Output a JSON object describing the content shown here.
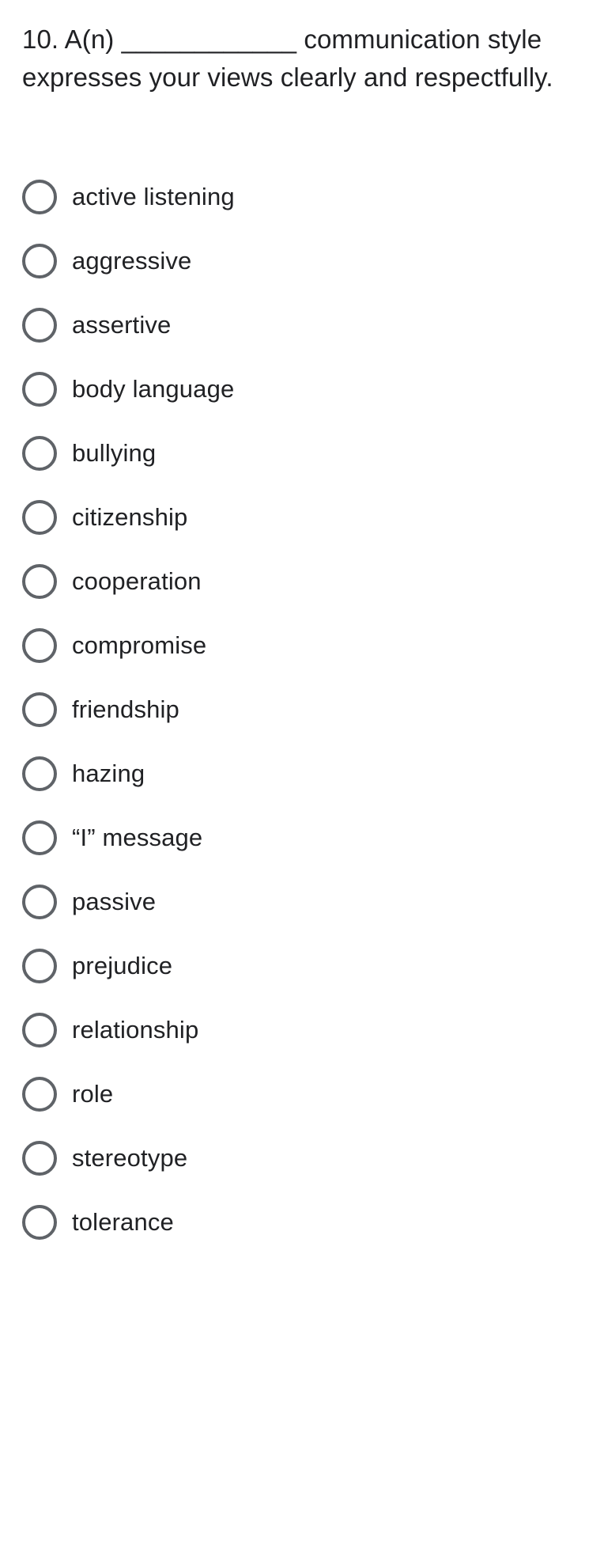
{
  "question": {
    "number": "10.",
    "text": "10. A(n) ____________ communication style expresses your views clearly and respectfully."
  },
  "options": [
    {
      "label": "active listening",
      "selected": false
    },
    {
      "label": "aggressive",
      "selected": false
    },
    {
      "label": "assertive",
      "selected": false
    },
    {
      "label": "body language",
      "selected": false
    },
    {
      "label": "bullying",
      "selected": false
    },
    {
      "label": "citizenship",
      "selected": false
    },
    {
      "label": "cooperation",
      "selected": false
    },
    {
      "label": "compromise",
      "selected": false
    },
    {
      "label": "friendship",
      "selected": false
    },
    {
      "label": "hazing",
      "selected": false
    },
    {
      "label": "“I” message",
      "selected": false
    },
    {
      "label": "passive",
      "selected": false
    },
    {
      "label": "prejudice",
      "selected": false
    },
    {
      "label": "relationship",
      "selected": false
    },
    {
      "label": "role",
      "selected": false
    },
    {
      "label": "stereotype",
      "selected": false
    },
    {
      "label": "tolerance",
      "selected": false
    }
  ],
  "colors": {
    "background": "#ffffff",
    "text": "#202124",
    "radio_border": "#5f6368"
  }
}
